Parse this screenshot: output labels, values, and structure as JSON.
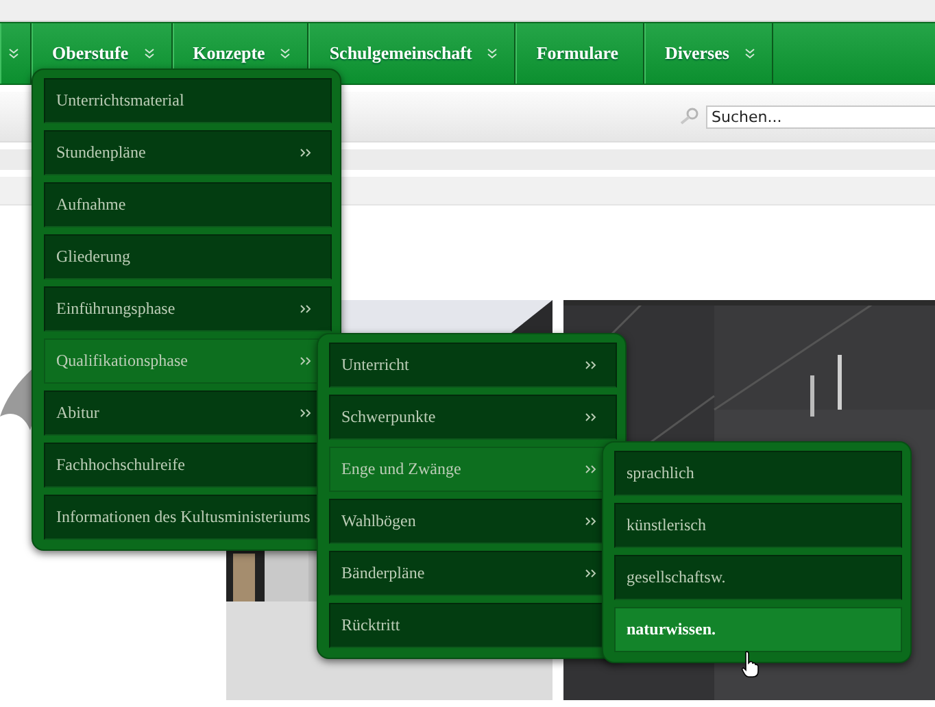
{
  "nav": [
    {
      "has_dropdown": true,
      "expanded": false
    },
    {
      "label": "Oberstufe",
      "has_dropdown": true,
      "expanded": true,
      "children": [
        {
          "label": "Unterrichtsmaterial",
          "has_submenu": false,
          "expanded": false
        },
        {
          "label": "Stundenpläne",
          "has_submenu": true,
          "expanded": false
        },
        {
          "label": "Aufnahme",
          "has_submenu": false,
          "expanded": false
        },
        {
          "label": "Gliederung",
          "has_submenu": false,
          "expanded": false
        },
        {
          "label": "Einführungsphase",
          "has_submenu": true,
          "expanded": false
        },
        {
          "label": "Qualifikationsphase",
          "has_submenu": true,
          "expanded": true,
          "children": [
            {
              "label": "Unterricht",
              "has_submenu": true,
              "expanded": false
            },
            {
              "label": "Schwerpunkte",
              "has_submenu": true,
              "expanded": false
            },
            {
              "label": "Enge und Zwänge",
              "has_submenu": true,
              "expanded": true,
              "children": [
                {
                  "label": "sprachlich",
                  "selected": false
                },
                {
                  "label": "künstlerisch",
                  "selected": false
                },
                {
                  "label": "gesellschaftsw.",
                  "selected": false
                },
                {
                  "label": "naturwissen.",
                  "selected": true
                }
              ]
            },
            {
              "label": "Wahlbögen",
              "has_submenu": true,
              "expanded": false
            },
            {
              "label": "Bänderpläne",
              "has_submenu": true,
              "expanded": false
            },
            {
              "label": "Rücktritt",
              "has_submenu": false,
              "expanded": false
            }
          ]
        },
        {
          "label": "Abitur",
          "has_submenu": true,
          "expanded": false
        },
        {
          "label": "Fachhochschulreife",
          "has_submenu": false,
          "expanded": false
        },
        {
          "label": "Informationen des Kultusministeriums",
          "has_submenu": false,
          "expanded": false
        }
      ]
    },
    {
      "label": "Konzepte",
      "has_dropdown": true,
      "expanded": false
    },
    {
      "label": "Schulgemeinschaft",
      "has_dropdown": true,
      "expanded": false
    },
    {
      "label": "Formulare",
      "has_dropdown": false,
      "expanded": false
    },
    {
      "label": "Diverses",
      "has_dropdown": true,
      "expanded": false
    }
  ],
  "search": {
    "placeholder": "Suchen..."
  }
}
